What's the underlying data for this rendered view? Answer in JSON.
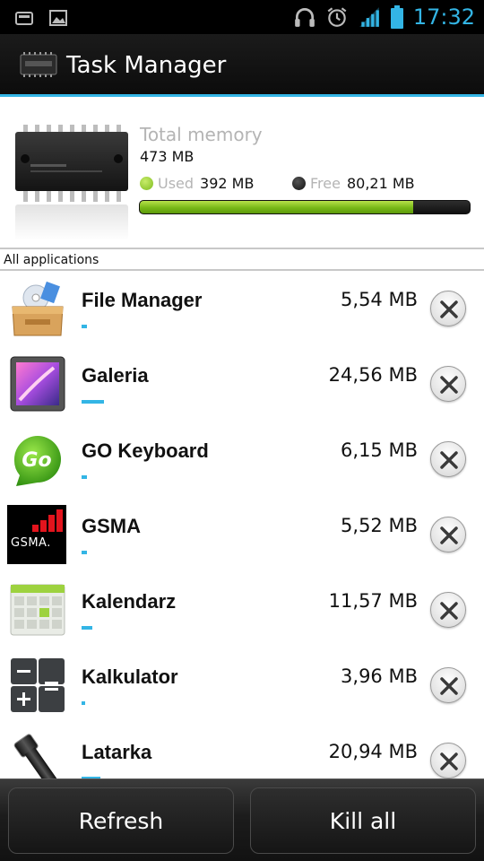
{
  "status_bar": {
    "left_icons": [
      "sd-card-icon",
      "picture-icon"
    ],
    "right_icons": [
      "headset-icon",
      "alarm-icon",
      "signal-icon",
      "battery-icon"
    ],
    "time": "17:32",
    "accent_color": "#33b5e5"
  },
  "action_bar": {
    "title": "Task Manager",
    "icon": "memory-chip-icon"
  },
  "memory": {
    "title": "Total memory",
    "total": "473 MB",
    "used_label": "Used",
    "used_value": "392 MB",
    "free_label": "Free",
    "free_value": "80,21 MB",
    "used_fraction": 0.83,
    "used_color": "#8cc63f",
    "free_color": "#222222"
  },
  "section": {
    "label": "All applications"
  },
  "apps": [
    {
      "name": "File Manager",
      "size": "5,54 MB",
      "icon": "file-manager-icon",
      "usage_fraction": 0.015
    },
    {
      "name": "Galeria",
      "size": "24,56 MB",
      "icon": "gallery-icon",
      "usage_fraction": 0.062
    },
    {
      "name": "GO Keyboard",
      "size": "6,15 MB",
      "icon": "go-keyboard-icon",
      "usage_fraction": 0.015
    },
    {
      "name": "GSMA",
      "size": "5,52 MB",
      "icon": "gsma-icon",
      "usage_fraction": 0.015
    },
    {
      "name": "Kalendarz",
      "size": "11,57 MB",
      "icon": "calendar-icon",
      "usage_fraction": 0.03
    },
    {
      "name": "Kalkulator",
      "size": "3,96 MB",
      "icon": "calculator-icon",
      "usage_fraction": 0.01
    },
    {
      "name": "Latarka",
      "size": "20,94 MB",
      "icon": "flashlight-icon",
      "usage_fraction": 0.052
    }
  ],
  "buttons": {
    "refresh": "Refresh",
    "kill_all": "Kill all"
  },
  "kill_icon": "close-icon"
}
